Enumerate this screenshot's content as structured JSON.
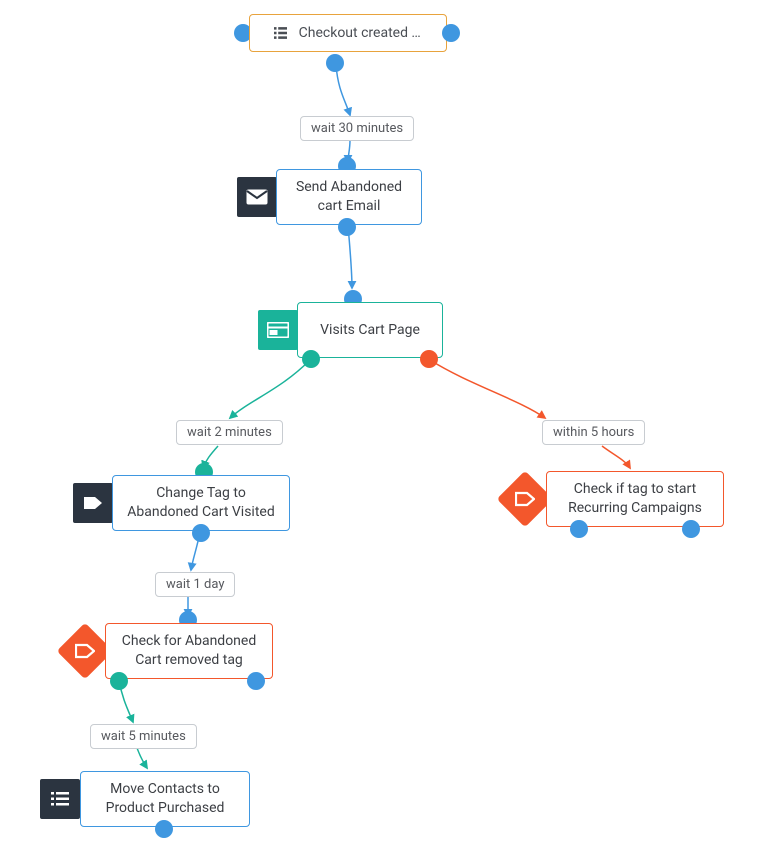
{
  "colors": {
    "blue": "#3f97e0",
    "teal": "#1ab39a",
    "orange": "#f3572c",
    "dark": "#2b3440",
    "amber": "#e8a33d"
  },
  "nodes": {
    "trigger": {
      "label": "Checkout created …",
      "icon": "list"
    },
    "wait_30m": {
      "label": "wait 30 minutes"
    },
    "send_email": {
      "label": "Send Abandoned cart Email",
      "icon": "mail"
    },
    "visits_cart": {
      "label": "Visits Cart Page",
      "icon": "webpage"
    },
    "wait_2m": {
      "label": "wait 2 minutes"
    },
    "within_5h": {
      "label": "within 5 hours"
    },
    "change_tag": {
      "label": "Change Tag to Abandoned Cart Visited",
      "icon": "tag"
    },
    "check_recurring": {
      "label": "Check if tag to start Recurring Campaigns",
      "icon": "check-tag"
    },
    "wait_1d": {
      "label": "wait 1 day"
    },
    "check_removed": {
      "label": "Check for Abandoned Cart removed tag",
      "icon": "check-tag"
    },
    "wait_5m": {
      "label": "wait 5 minutes"
    },
    "move_contacts": {
      "label": "Move Contacts to Product Purchased",
      "icon": "list"
    }
  },
  "chart_data": {
    "type": "flow",
    "nodes": [
      {
        "id": "trigger",
        "kind": "trigger",
        "label": "Checkout created …"
      },
      {
        "id": "wait_30m",
        "kind": "wait",
        "label": "wait 30 minutes"
      },
      {
        "id": "send_email",
        "kind": "action",
        "label": "Send Abandoned cart Email"
      },
      {
        "id": "visits_cart",
        "kind": "condition",
        "label": "Visits Cart Page"
      },
      {
        "id": "wait_2m",
        "kind": "wait",
        "label": "wait 2 minutes",
        "branch": "yes"
      },
      {
        "id": "within_5h",
        "kind": "wait",
        "label": "within 5 hours",
        "branch": "no"
      },
      {
        "id": "change_tag",
        "kind": "action",
        "label": "Change Tag to Abandoned Cart Visited"
      },
      {
        "id": "check_recurring",
        "kind": "condition",
        "label": "Check if tag to start Recurring Campaigns"
      },
      {
        "id": "wait_1d",
        "kind": "wait",
        "label": "wait 1 day"
      },
      {
        "id": "check_removed",
        "kind": "condition",
        "label": "Check for Abandoned Cart removed tag"
      },
      {
        "id": "wait_5m",
        "kind": "wait",
        "label": "wait 5 minutes"
      },
      {
        "id": "move_contacts",
        "kind": "action",
        "label": "Move Contacts to Product Purchased"
      }
    ],
    "edges": [
      {
        "from": "trigger",
        "to": "wait_30m",
        "color": "blue"
      },
      {
        "from": "wait_30m",
        "to": "send_email",
        "color": "blue"
      },
      {
        "from": "send_email",
        "to": "visits_cart",
        "color": "blue"
      },
      {
        "from": "visits_cart",
        "to": "wait_2m",
        "color": "teal",
        "branch": "yes"
      },
      {
        "from": "wait_2m",
        "to": "change_tag",
        "color": "teal"
      },
      {
        "from": "change_tag",
        "to": "wait_1d",
        "color": "blue"
      },
      {
        "from": "wait_1d",
        "to": "check_removed",
        "color": "blue"
      },
      {
        "from": "check_removed",
        "to": "wait_5m",
        "color": "teal",
        "branch": "yes"
      },
      {
        "from": "wait_5m",
        "to": "move_contacts",
        "color": "teal"
      },
      {
        "from": "visits_cart",
        "to": "within_5h",
        "color": "orange",
        "branch": "no"
      },
      {
        "from": "within_5h",
        "to": "check_recurring",
        "color": "orange"
      }
    ]
  }
}
